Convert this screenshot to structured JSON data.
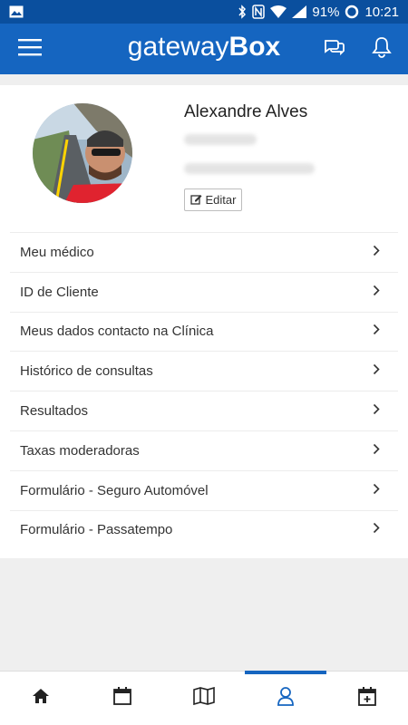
{
  "status_bar": {
    "battery": "91%",
    "time": "10:21",
    "icons": [
      "image-icon",
      "bluetooth-icon",
      "nfc-icon",
      "wifi-icon",
      "signal-icon",
      "battery-ring-icon"
    ]
  },
  "app_bar": {
    "title_light": "gateway",
    "title_bold": "Box",
    "icons": [
      "menu-icon",
      "chat-icon",
      "bell-icon"
    ]
  },
  "profile": {
    "name": "Alexandre Alves",
    "edit_label": "Editar"
  },
  "menu": {
    "items": [
      {
        "label": "Meu médico"
      },
      {
        "label": "ID de Cliente"
      },
      {
        "label": "Meus dados contacto na Clínica"
      },
      {
        "label": "Histórico de consultas"
      },
      {
        "label": "Resultados"
      },
      {
        "label": "Taxas moderadoras"
      },
      {
        "label": "Formulário - Seguro Automóvel"
      },
      {
        "label": "Formulário - Passatempo"
      }
    ]
  },
  "bottom_nav": {
    "items": [
      "home-icon",
      "calendar-icon",
      "map-icon",
      "profile-icon",
      "appointment-add-icon"
    ],
    "active": "profile-icon"
  },
  "colors": {
    "primary": "#1565c0",
    "status_bar": "#0a4f9e",
    "background": "#efefef"
  }
}
